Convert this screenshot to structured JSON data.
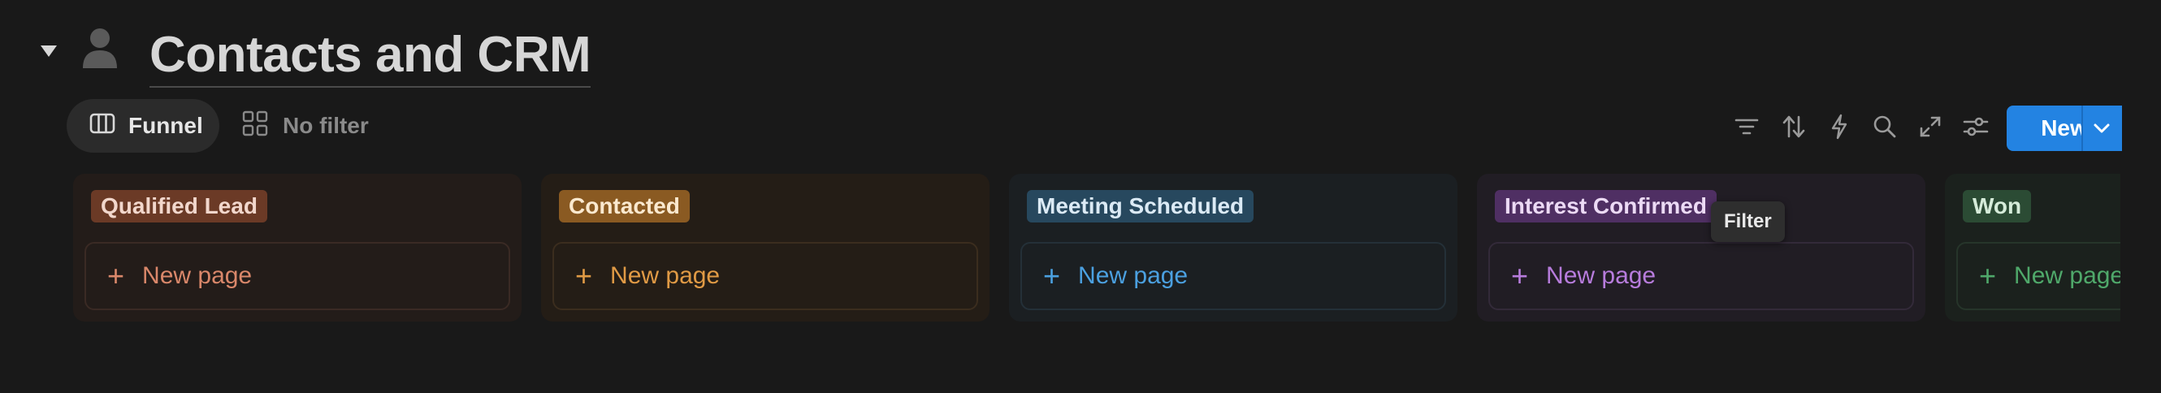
{
  "page": {
    "title": "Contacts and CRM",
    "icon": "person-icon"
  },
  "views": {
    "tabs": [
      {
        "label": "Funnel",
        "icon": "board-icon",
        "active": true
      },
      {
        "label": "No filter",
        "icon": "gallery-grid-icon",
        "active": false
      }
    ]
  },
  "toolbar": {
    "icons": [
      "filter-icon",
      "sort-icon",
      "automation-bolt-icon",
      "search-icon",
      "expand-icon",
      "settings-sliders-icon"
    ],
    "new_label": "New",
    "accent": "#2383e2"
  },
  "tooltip": {
    "text": "Filter"
  },
  "columns": [
    {
      "name": "Qualified Lead",
      "new_page_label": "New page",
      "tag_bg": "#6b3a26",
      "tag_color": "#f2d7cc",
      "accent": "#d9876a",
      "bg": "#241d1a"
    },
    {
      "name": "Contacted",
      "new_page_label": "New page",
      "tag_bg": "#8a5a22",
      "tag_color": "#fbe9cf",
      "accent": "#e09a45",
      "bg": "#251e17"
    },
    {
      "name": "Meeting Scheduled",
      "new_page_label": "New page",
      "tag_bg": "#27485e",
      "tag_color": "#dbeaf5",
      "accent": "#4ba0e0",
      "bg": "#1b1f22"
    },
    {
      "name": "Interest Confirmed",
      "new_page_label": "New page",
      "tag_bg": "#4f2f63",
      "tag_color": "#ecdaf5",
      "accent": "#b77cdc",
      "bg": "#211d24"
    },
    {
      "name": "Won",
      "new_page_label": "New page",
      "tag_bg": "#2b4b34",
      "tag_color": "#d5ecd9",
      "accent": "#4fa86a",
      "bg": "#1b211d"
    }
  ]
}
